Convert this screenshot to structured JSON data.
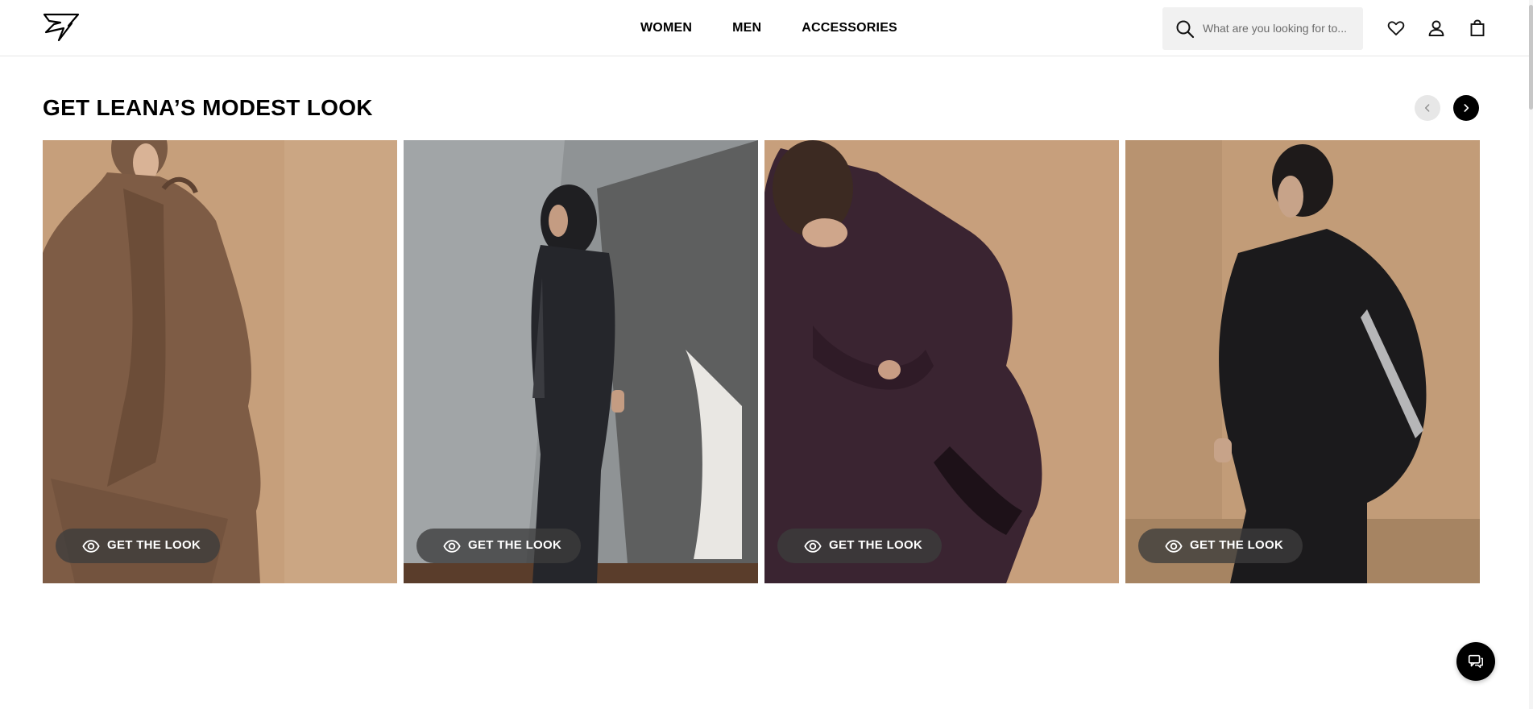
{
  "header": {
    "logo_icon": "gymshark-logo-icon",
    "nav": [
      {
        "label": "WOMEN"
      },
      {
        "label": "MEN"
      },
      {
        "label": "ACCESSORIES"
      }
    ],
    "search": {
      "placeholder": "What are you looking for to...",
      "icon": "search-icon"
    },
    "icons": [
      "heart-icon",
      "user-icon",
      "bag-icon"
    ]
  },
  "section": {
    "title": "GET LEANA’S MODEST LOOK",
    "carousel": {
      "prev_icon": "chevron-left-icon",
      "next_icon": "chevron-right-icon"
    },
    "cards": [
      {
        "button_label": "GET THE LOOK",
        "icon": "eye-icon"
      },
      {
        "button_label": "GET THE LOOK",
        "icon": "eye-icon"
      },
      {
        "button_label": "GET THE LOOK",
        "icon": "eye-icon"
      },
      {
        "button_label": "GET THE LOOK",
        "icon": "eye-icon"
      }
    ]
  },
  "chat": {
    "icon": "chat-icon"
  },
  "colors": {
    "tan_background": "#c7a07e",
    "grey_background": "#8f9395",
    "button_bg": "#3c3c3c",
    "accent_black": "#000000"
  }
}
